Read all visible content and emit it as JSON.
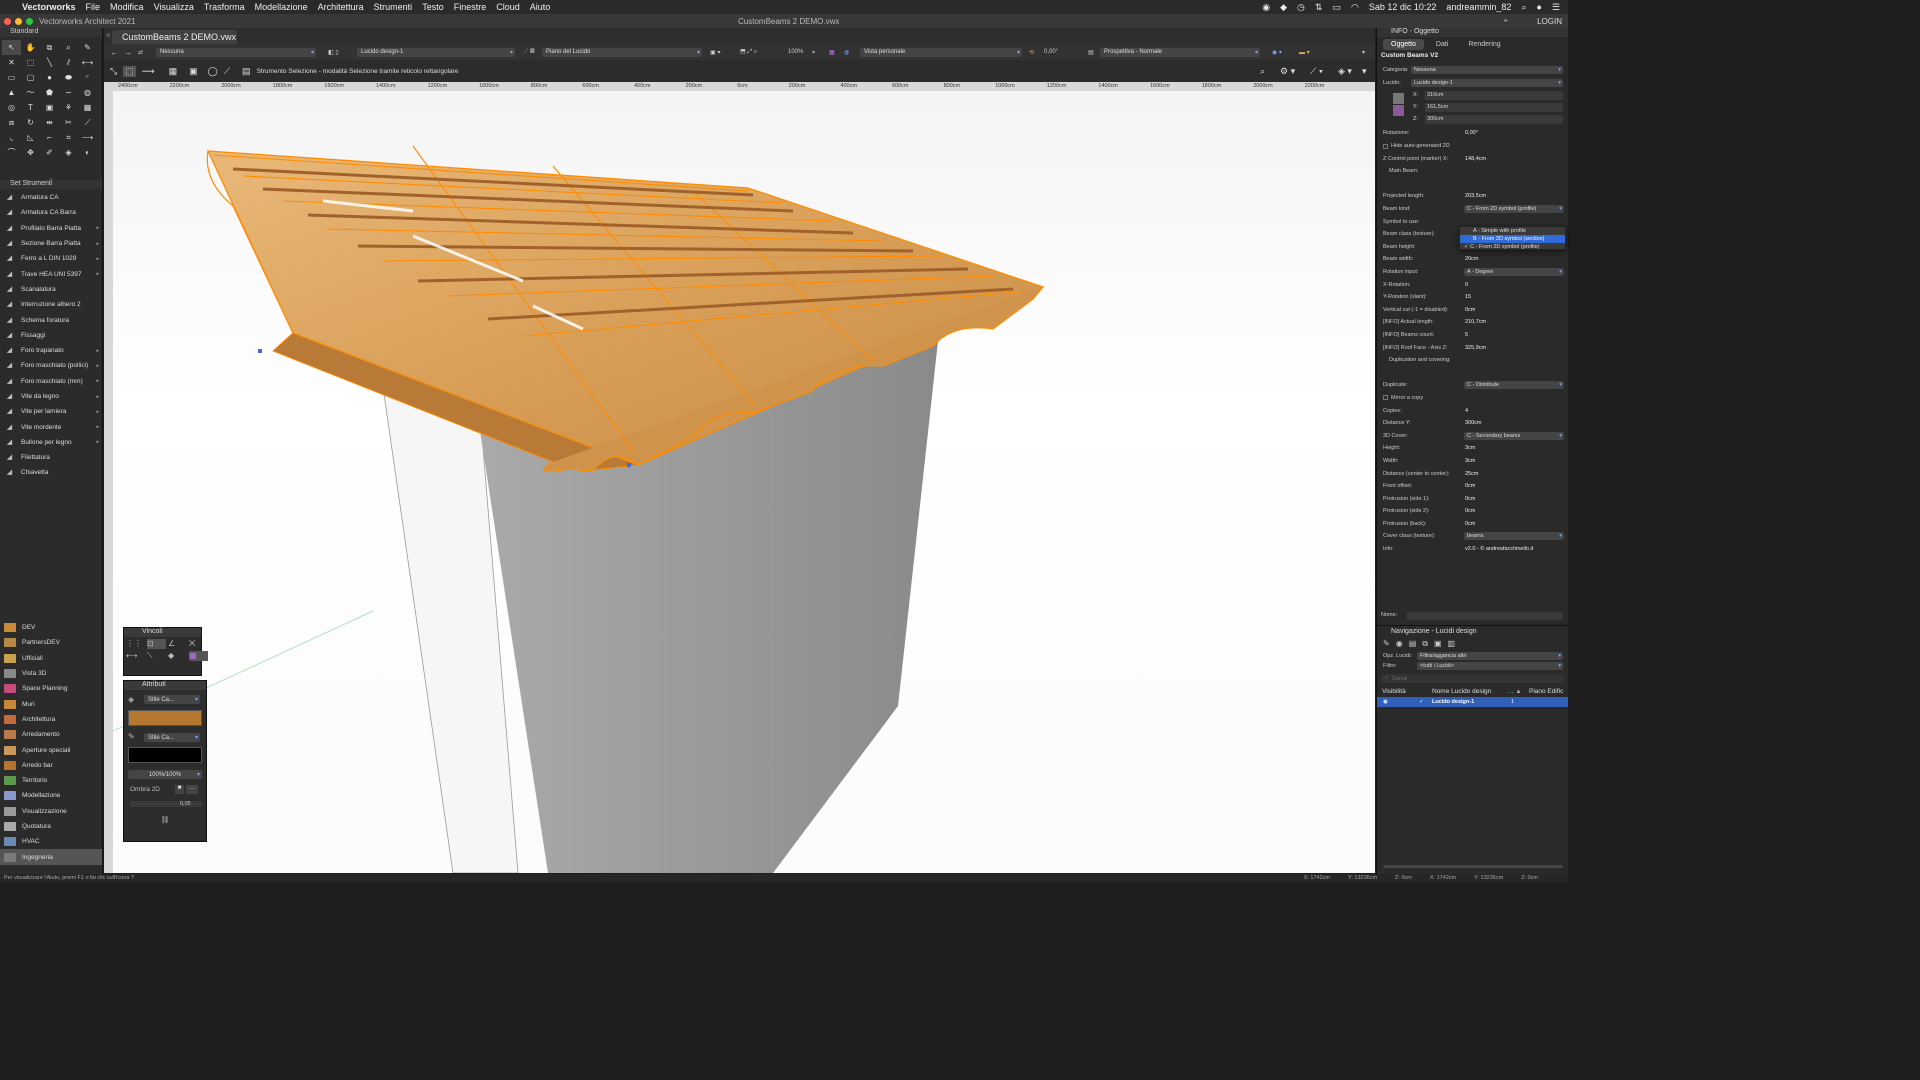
{
  "menubar": {
    "app": "Vectorworks",
    "items": [
      "File",
      "Modifica",
      "Visualizza",
      "Trasforma",
      "Modellazione",
      "Architettura",
      "Strumenti",
      "Testo",
      "Finestre",
      "Cloud",
      "Aiuto"
    ],
    "datetime": "Sab 12 dic  10:22",
    "user": "andreammin_82"
  },
  "window": {
    "app_title": "Vectorworks Architect 2021",
    "file_title": "CustomBeams 2 DEMO.vwx",
    "login": "LOGIN"
  },
  "tabs": {
    "document": "CustomBeams 2 DEMO.vwx"
  },
  "left_panel": {
    "tools_header": "Standard",
    "set_header": "Set Strumenti",
    "tool_set": [
      {
        "label": "Armatura CA",
        "arrow": false
      },
      {
        "label": "Armatura CA Barra",
        "arrow": false
      },
      {
        "label": "Profilato Barra Piatta",
        "arrow": true
      },
      {
        "label": "Sezione Barra Piatta",
        "arrow": true
      },
      {
        "label": "Ferro a L DIN 1029",
        "arrow": true
      },
      {
        "label": "Trave HEA UNI 5397",
        "arrow": true
      },
      {
        "label": "Scanalatura",
        "arrow": false
      },
      {
        "label": "Interruzione albero 2",
        "arrow": false
      },
      {
        "label": "Schema foratura",
        "arrow": false
      },
      {
        "label": "Fissaggi",
        "arrow": false
      },
      {
        "label": "Foro trapanato",
        "arrow": true
      },
      {
        "label": "Foro maschiato (pollici)",
        "arrow": true
      },
      {
        "label": "Foro maschiato (mm)",
        "arrow": true
      },
      {
        "label": "Vite da legno",
        "arrow": true
      },
      {
        "label": "Vite per lamiera",
        "arrow": true
      },
      {
        "label": "Vite mordente",
        "arrow": true
      },
      {
        "label": "Bullone per legno",
        "arrow": true
      },
      {
        "label": "Filettatura",
        "arrow": false
      },
      {
        "label": "Chiavetta",
        "arrow": false
      }
    ],
    "categories": [
      {
        "label": "DEV",
        "color": "#c98a3c",
        "selected": false
      },
      {
        "label": "PartnersDEV",
        "color": "#b98a45",
        "selected": false
      },
      {
        "label": "Ufficiali",
        "color": "#c9a24c",
        "selected": false
      },
      {
        "label": "Vista 3D",
        "color": "#8a8a8a",
        "selected": false
      },
      {
        "label": "Space Planning",
        "color": "#c44c7a",
        "selected": false
      },
      {
        "label": "Muri",
        "color": "#c9873c",
        "selected": false
      },
      {
        "label": "Architettura",
        "color": "#c46a3c",
        "selected": false
      },
      {
        "label": "Arredamento",
        "color": "#b87a4a",
        "selected": false
      },
      {
        "label": "Aperture speciali",
        "color": "#c99a5c",
        "selected": false
      },
      {
        "label": "Arredo bar",
        "color": "#b8742e",
        "selected": false
      },
      {
        "label": "Territorio",
        "color": "#5c9a4c",
        "selected": false
      },
      {
        "label": "Modellazione",
        "color": "#8a9acc",
        "selected": false
      },
      {
        "label": "Visualizzazione",
        "color": "#9a9a9a",
        "selected": false
      },
      {
        "label": "Quotatura",
        "color": "#aaaaaa",
        "selected": false
      },
      {
        "label": "HVAC",
        "color": "#6a8ab8",
        "selected": false
      },
      {
        "label": "Ingegneria",
        "color": "#7a7a7a",
        "selected": true
      }
    ]
  },
  "view_bar": {
    "class": "Nessuna",
    "layer": "Lucido design-1",
    "plane": "Piano del Lucido",
    "zoom": "100%",
    "view": "Vista personale",
    "rotation": "0,00°",
    "projection": "Prospettiva - Normale"
  },
  "mode_bar": {
    "hint": "Strumento Selezione - modalità Selezione tramite reticolo rettangolare"
  },
  "ruler": {
    "ticks": [
      "2400cm",
      "2200cm",
      "2000cm",
      "1800cm",
      "1600cm",
      "1400cm",
      "1200cm",
      "1000cm",
      "800cm",
      "600cm",
      "400cm",
      "200cm",
      "0cm",
      "200cm",
      "400cm",
      "600cm",
      "800cm",
      "1000cm",
      "1200cm",
      "1400cm",
      "1600cm",
      "1800cm",
      "2000cm",
      "2200cm"
    ]
  },
  "palettes": {
    "constraints_title": "Vincoli",
    "attributes_title": "Attributi",
    "fill_style": "Stile Ca...",
    "pen_style": "Stile Ca...",
    "opacity": "100%/100%",
    "shadow_label": "Ombra 2D",
    "shadow_value": "0,05"
  },
  "info_panel": {
    "title": "INFO - Oggetto",
    "tabs": [
      {
        "label": "Oggetto",
        "active": true
      },
      {
        "label": "Dati",
        "active": false
      },
      {
        "label": "Rendering",
        "active": false
      }
    ],
    "object_name": "Custom Beams V2",
    "category_label": "Categoria:",
    "category_value": "Nessuna",
    "layer_label": "Lucido:",
    "layer_value": "Lucido design-1",
    "x": "310cm",
    "y": "161,5cm",
    "z": "300cm",
    "rows": [
      {
        "label": "Rotazione:",
        "value": "0,00°",
        "type": "text"
      },
      {
        "label": "Hide auto-generated 2D",
        "value": "",
        "type": "check"
      },
      {
        "label": "Z Control point (marker) X:",
        "value": "148,4cm",
        "type": "text"
      },
      {
        "label": "Main Beam:",
        "value": "",
        "type": "header"
      },
      {
        "label": "",
        "value": "",
        "type": "blank"
      },
      {
        "label": "Projected length:",
        "value": "203,5cm",
        "type": "text"
      },
      {
        "label": "Beam kind:",
        "value": "C - From 2D symbol (profile)",
        "type": "dropdown"
      },
      {
        "label": "Symbol to use:",
        "value": "",
        "type": "text"
      },
      {
        "label": "Beam class (texture):",
        "value": "",
        "type": "text"
      },
      {
        "label": "Beam height:",
        "value": "25cm",
        "type": "text"
      },
      {
        "label": "Beam width:",
        "value": "20cm",
        "type": "text"
      },
      {
        "label": "Rotation input:",
        "value": "A - Degree",
        "type": "dropdown"
      },
      {
        "label": "X-Rotation:",
        "value": "0",
        "type": "text"
      },
      {
        "label": "Y-Rotation (slant):",
        "value": "15",
        "type": "text"
      },
      {
        "label": "Vertical cut (-1 = disabled):",
        "value": "0cm",
        "type": "text"
      },
      {
        "label": "[INFO] Actual length:",
        "value": "210,7cm",
        "type": "text"
      },
      {
        "label": "[INFO] Beams count:",
        "value": "5",
        "type": "text"
      },
      {
        "label": "[INFO] Roof Face - Axis Z:",
        "value": "325,9cm",
        "type": "text"
      },
      {
        "label": "Duplication and covering:",
        "value": "",
        "type": "header"
      },
      {
        "label": "",
        "value": "",
        "type": "blank"
      },
      {
        "label": "Duplicate:",
        "value": "C - Distribute",
        "type": "dropdown"
      },
      {
        "label": "Mirror a copy",
        "value": "",
        "type": "check"
      },
      {
        "label": "Copies:",
        "value": "4",
        "type": "text"
      },
      {
        "label": "Distance Y:",
        "value": "300cm",
        "type": "text"
      },
      {
        "label": "3D Cover:",
        "value": "C - Secondary beams",
        "type": "dropdown"
      },
      {
        "label": "Height:",
        "value": "3cm",
        "type": "text"
      },
      {
        "label": "Width:",
        "value": "3cm",
        "type": "text"
      },
      {
        "label": "Distance (center to center):",
        "value": "25cm",
        "type": "text"
      },
      {
        "label": "Front offset:",
        "value": "0cm",
        "type": "text"
      },
      {
        "label": "Protrusion (side 1):",
        "value": "0cm",
        "type": "text"
      },
      {
        "label": "Protrusion (side 2):",
        "value": "0cm",
        "type": "text"
      },
      {
        "label": "Protrusion (back):",
        "value": "0cm",
        "type": "text"
      },
      {
        "label": "Cover class (texture):",
        "value": "beams",
        "type": "dropdown"
      },
      {
        "label": "Info:",
        "value": "v2.0 - © andreafacchinello.it",
        "type": "text"
      }
    ],
    "popup_options": [
      {
        "label": "A - Simple with profile",
        "highlight": false
      },
      {
        "label": "B - From 2D symbol (section)",
        "highlight": true
      },
      {
        "label": "C - From 2D symbol (profile)",
        "highlight": false,
        "checked": true
      }
    ],
    "name_label": "Nome:"
  },
  "nav_panel": {
    "title": "Navigazione - Lucidi design",
    "opt_label": "Opz. Lucidi:",
    "opt_value": "Filtra/aggancia altri",
    "filter_label": "Filtro:",
    "filter_value": "<tutti i Lucidi>",
    "search_placeholder": "Cerca",
    "col_visibility": "Visibilità",
    "col_name": "Nome Lucido design",
    "col_plane": "Piano Edific",
    "row_name": "Lucido design-1",
    "row_num": "1"
  },
  "status": {
    "hint": "Per visualizzare l'Aiuto, premi F1 o fai clic sull'icona ?",
    "x1": "X: 1742cm",
    "y1": "Y: 13236cm",
    "z1": "Z: 0cm",
    "x2": "X: 1742cm",
    "y2": "Y: 13236cm",
    "z2": "Z: 0cm"
  }
}
